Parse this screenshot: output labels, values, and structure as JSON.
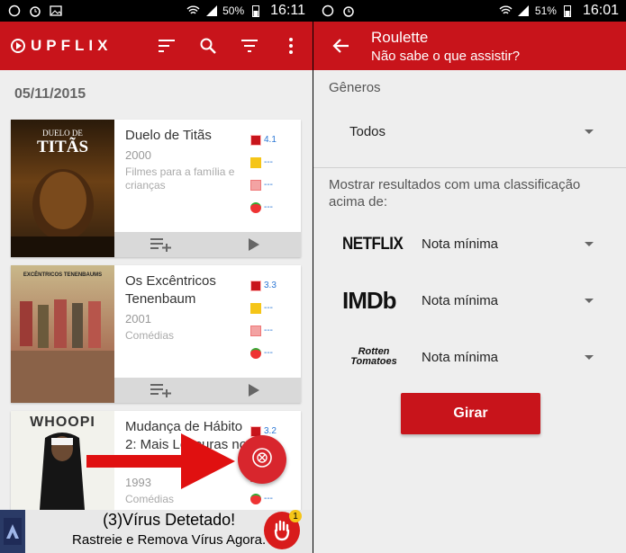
{
  "left_screen": {
    "status": {
      "battery": "50%",
      "time": "16:11"
    },
    "app": {
      "logo": "UPFLIX"
    },
    "date": "05/11/2015",
    "movies": [
      {
        "title": "Duelo de Titãs",
        "year": "2000",
        "genre": "Filmes para a família e crianças",
        "netflix": "4.1",
        "imdb": "---",
        "popcorn": "---",
        "tomato": "---"
      },
      {
        "title": "Os Excêntricos Tenenbaum",
        "year": "2001",
        "genre": "Comédias",
        "netflix": "3.3",
        "imdb": "---",
        "popcorn": "---",
        "tomato": "---"
      },
      {
        "title": "Mudança de Hábito 2: Mais Loucuras no Convento",
        "year": "1993",
        "genre": "Comédias",
        "netflix": "3.2",
        "imdb": "---",
        "popcorn": "---",
        "tomato": "---"
      }
    ],
    "ad": {
      "line1": "(3)Vírus Detetado!",
      "line2": "Rastreie e Remova Vírus Agora.",
      "badge": "1"
    }
  },
  "right_screen": {
    "status": {
      "battery": "51%",
      "time": "16:01"
    },
    "title": "Roulette",
    "subtitle": "Não sabe o que assistir?",
    "genres_label": "Gêneros",
    "genres_value": "Todos",
    "ratings_label": "Mostrar resultados com uma classificação acima de:",
    "filters": [
      {
        "brand": "NETFLIX",
        "value": "Nota mínima"
      },
      {
        "brand": "IMDb",
        "value": "Nota mínima"
      },
      {
        "brand": "Rotten Tomatoes",
        "value": "Nota mínima"
      }
    ],
    "spin_button": "Girar"
  },
  "colors": {
    "brand_red": "#c8141b",
    "rating_blue": "#2b77d5"
  }
}
